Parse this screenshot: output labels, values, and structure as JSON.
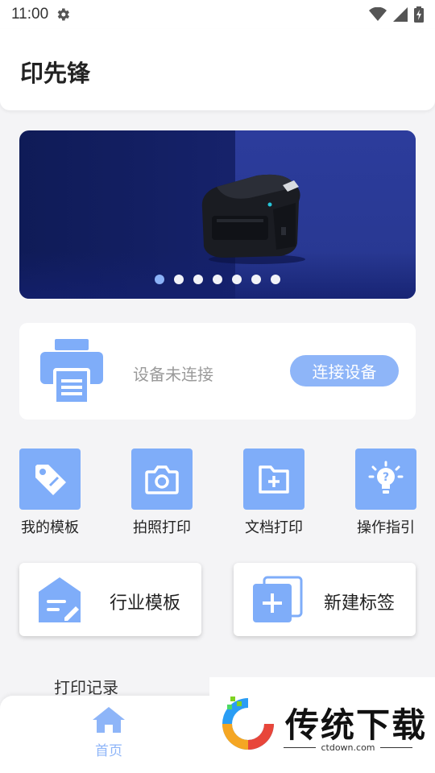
{
  "status_bar": {
    "time": "11:00",
    "icons": [
      "settings-icon",
      "wifi-icon",
      "signal-icon",
      "battery-charging-icon"
    ]
  },
  "header": {
    "title": "印先锋"
  },
  "banner": {
    "slide_count": 7,
    "active_slide": 1
  },
  "device": {
    "status_text": "设备未连接",
    "connect_label": "连接设备"
  },
  "quick_actions": [
    {
      "label": "我的模板",
      "icon": "tag-icon"
    },
    {
      "label": "拍照打印",
      "icon": "camera-icon"
    },
    {
      "label": "文档打印",
      "icon": "folder-add-icon"
    },
    {
      "label": "操作指引",
      "icon": "lightbulb-icon"
    }
  ],
  "big_cards": [
    {
      "label": "行业模板",
      "icon": "template-edit-icon"
    },
    {
      "label": "新建标签",
      "icon": "new-label-icon"
    }
  ],
  "sections": {
    "print_records": "打印记录"
  },
  "bottom_nav": {
    "home_label": "首页"
  },
  "watermark": {
    "brand": "传统下载",
    "url": "ctdown.com"
  },
  "colors": {
    "accent": "#7fadf9",
    "button": "#8eb5f8",
    "banner_bg": "#16226b"
  }
}
